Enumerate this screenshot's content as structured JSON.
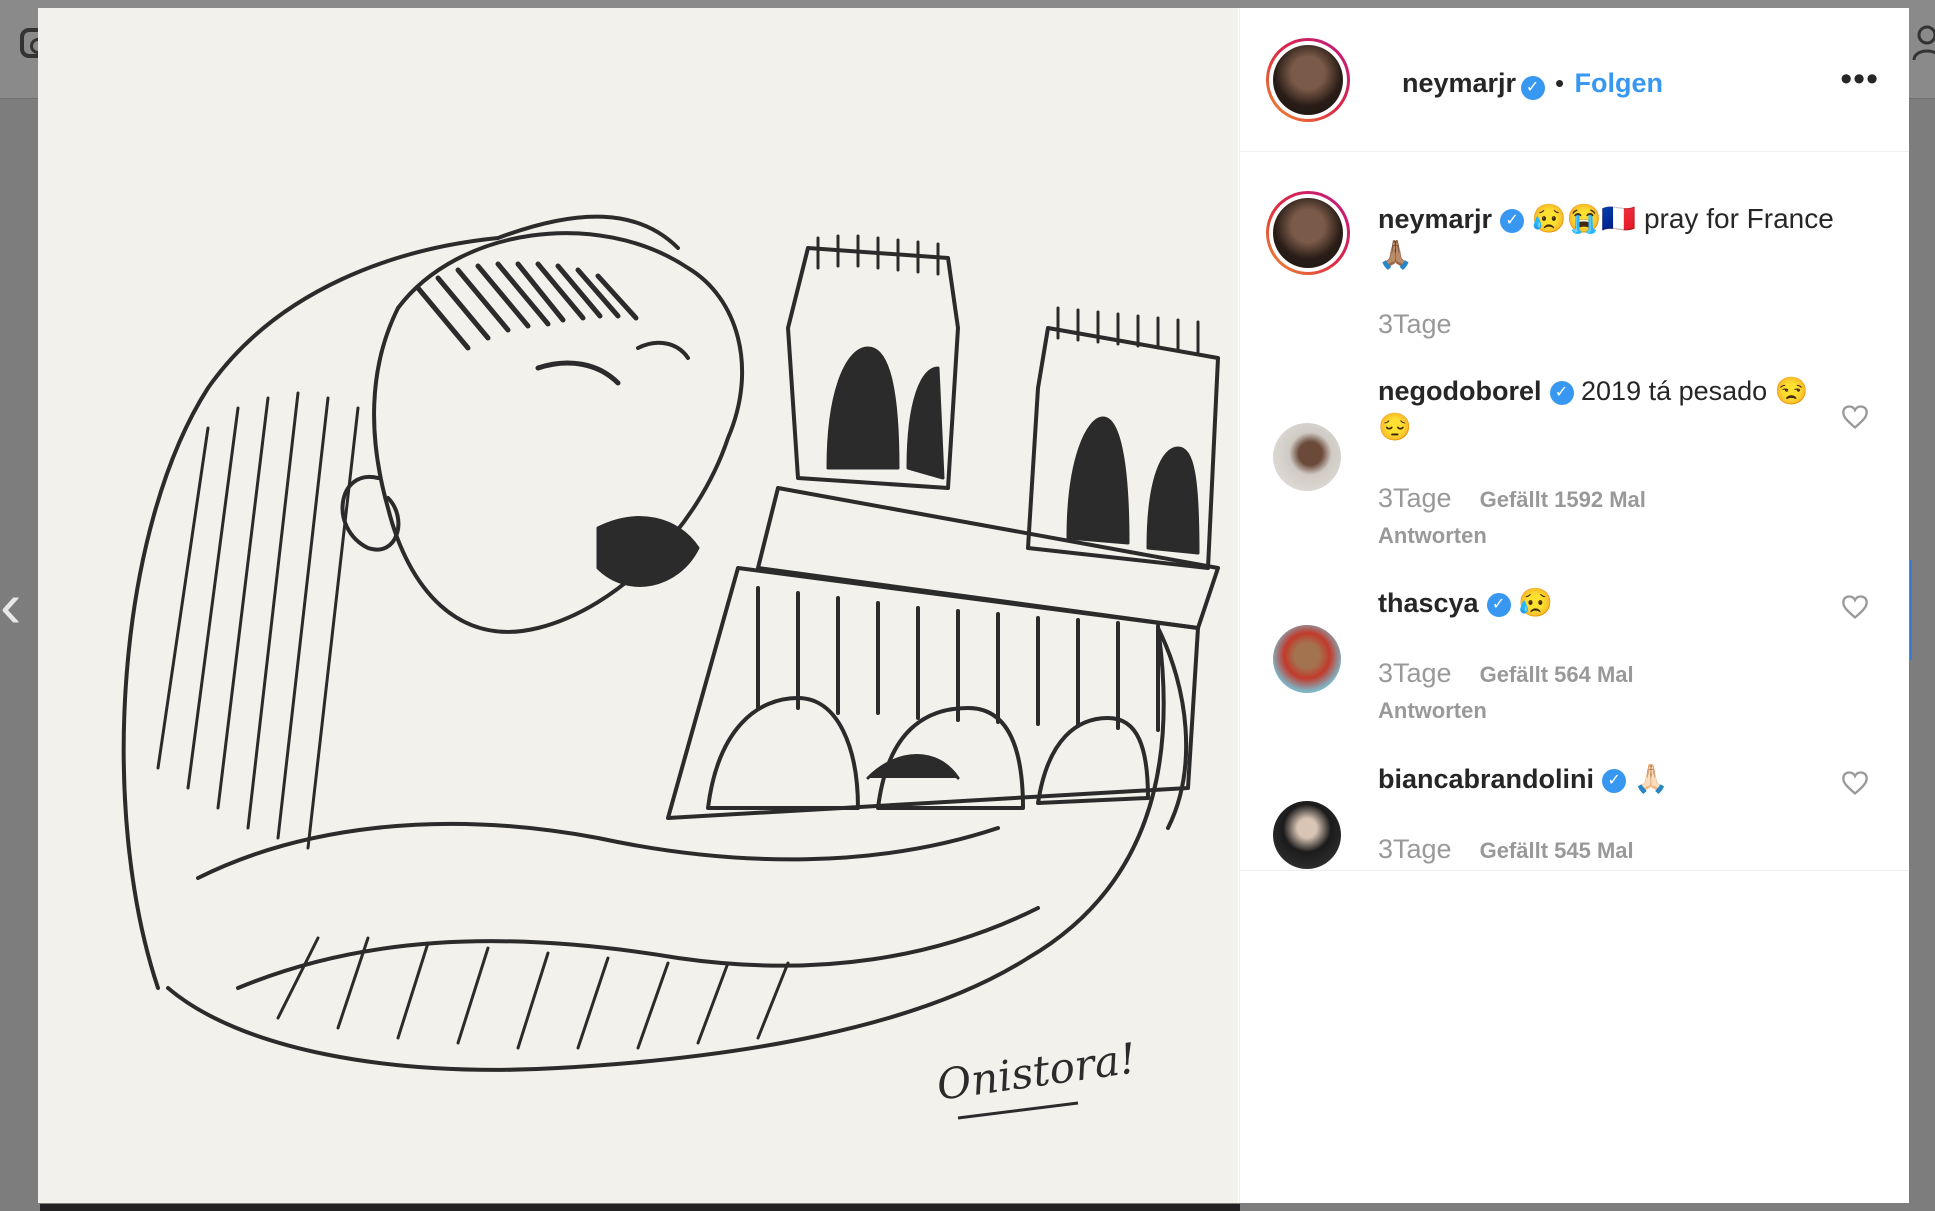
{
  "post": {
    "username": "neymarjr",
    "follow_label": "Folgen",
    "separator": "•",
    "more_label": "•••"
  },
  "caption": {
    "username": "neymarjr",
    "text": "😥😭🇫🇷 pray for France 🙏🏽",
    "time": "3Tage"
  },
  "comments": [
    {
      "username": "negodoborel",
      "text": "2019 tá pesado 😒😔",
      "time": "3Tage",
      "likes": "Gefällt 1592 Mal",
      "reply": "Antworten"
    },
    {
      "username": "thascya",
      "text": "😥",
      "time": "3Tage",
      "likes": "Gefällt 564 Mal",
      "reply": "Antworten"
    },
    {
      "username": "biancabrandolini",
      "text": "🙏🏻",
      "time": "3Tage",
      "likes": "Gefällt 545 Mal",
      "reply": ""
    }
  ],
  "photo": {
    "signature": "Onistora!",
    "description_icon": "pencil-sketch-hunchback-hugging-notre-dame"
  },
  "nav": {
    "prev_icon": "chevron-left-icon"
  },
  "colors": {
    "accent": "#3897f0",
    "text": "#262626",
    "muted": "#999999"
  }
}
